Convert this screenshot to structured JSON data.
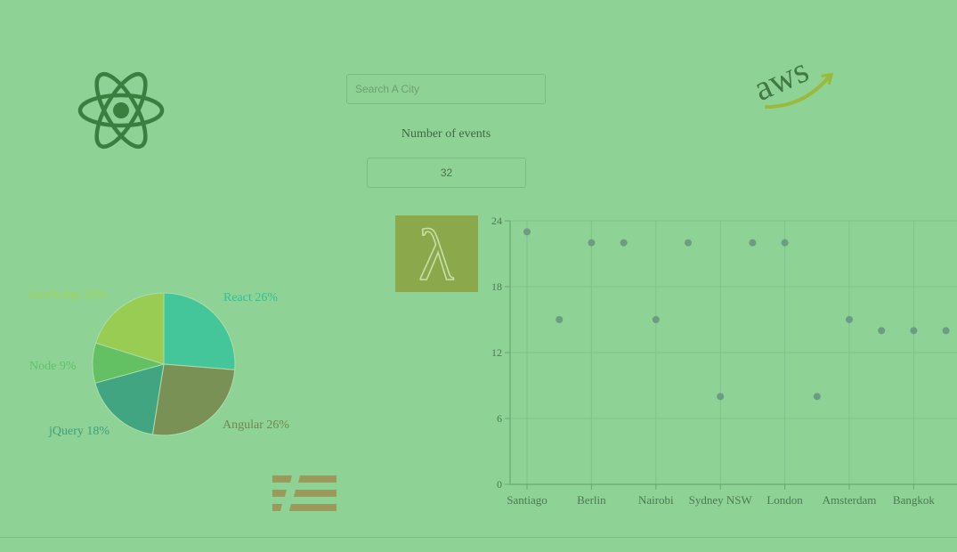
{
  "search": {
    "placeholder": "Search A City",
    "value": ""
  },
  "events": {
    "label": "Number of events",
    "value": "32"
  },
  "logos": {
    "react": "react-atom-logo",
    "aws": {
      "text": "aws"
    },
    "lambda": {
      "glyph": "λ"
    },
    "serverless": "serverless-logo"
  },
  "pie_chart": {
    "type": "pie",
    "slices": [
      {
        "label": "React 26%",
        "value": 26,
        "color": "#45c69a",
        "label_color": "#2fc29a"
      },
      {
        "label": "Angular 26%",
        "value": 26,
        "color": "#7a9155",
        "label_color": "#6f8a4e"
      },
      {
        "label": "jQuery 18%",
        "value": 18,
        "color": "#42a582",
        "label_color": "#3f9e80"
      },
      {
        "label": "Node 9%",
        "value": 9,
        "color": "#63c063",
        "label_color": "#5fc26a"
      },
      {
        "label": "JavaScript 20%",
        "value": 20,
        "color": "#98cc52",
        "label_color": "#a4d352"
      }
    ]
  },
  "chart_data": [
    {
      "type": "pie",
      "categories": [
        "React",
        "Angular",
        "jQuery",
        "Node",
        "JavaScript"
      ],
      "values": [
        26,
        26,
        18,
        9,
        20
      ]
    },
    {
      "type": "scatter",
      "x_tick_labels": [
        "Santiago",
        "Berlin",
        "Nairobi",
        "Sydney NSW",
        "London",
        "Amsterdam",
        "Bangkok"
      ],
      "y_ticks": [
        0,
        6,
        12,
        18,
        24
      ],
      "ylim": [
        0,
        24
      ],
      "grid": true,
      "points": [
        {
          "x": "Santiago",
          "y": 23
        },
        {
          "x": "",
          "y": 15
        },
        {
          "x": "Berlin",
          "y": 22
        },
        {
          "x": "",
          "y": 22
        },
        {
          "x": "Nairobi",
          "y": 15
        },
        {
          "x": "",
          "y": 22
        },
        {
          "x": "Sydney NSW",
          "y": 8
        },
        {
          "x": "",
          "y": 22
        },
        {
          "x": "London",
          "y": 22
        },
        {
          "x": "",
          "y": 8
        },
        {
          "x": "Amsterdam",
          "y": 15
        },
        {
          "x": "",
          "y": 14
        },
        {
          "x": "Bangkok",
          "y": 14
        },
        {
          "x": "",
          "y": 14
        }
      ],
      "colors": {
        "point": "#6a9d83",
        "grid": "#7fc48a",
        "axis": "#6aa874",
        "text": "#4b7a52"
      }
    }
  ]
}
